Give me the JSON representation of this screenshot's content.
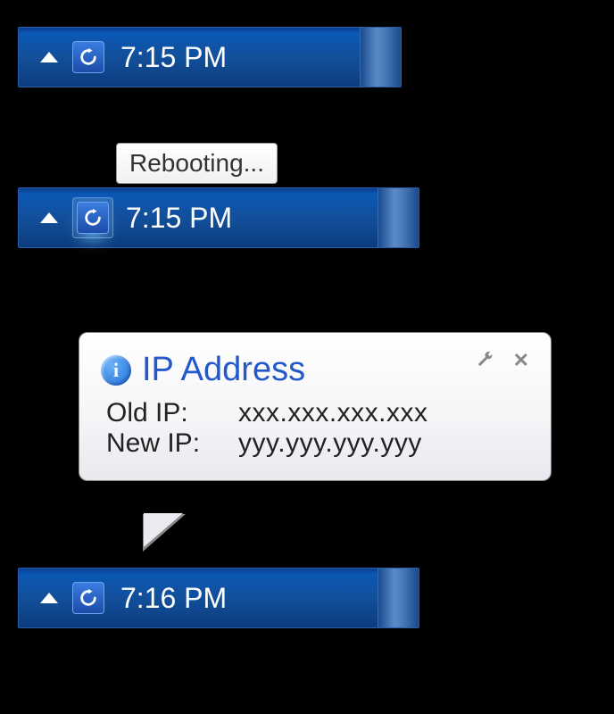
{
  "states": {
    "idle": {
      "time": "7:15 PM"
    },
    "rebooting": {
      "tooltip": "Rebooting...",
      "time": "7:15 PM"
    },
    "done": {
      "time": "7:16 PM"
    }
  },
  "balloon": {
    "title": "IP Address",
    "old_label": "Old IP:",
    "old_value": "xxx.xxx.xxx.xxx",
    "new_label": "New IP:",
    "new_value": "yyy.yyy.yyy.yyy"
  },
  "icons": {
    "info_glyph": "i"
  }
}
